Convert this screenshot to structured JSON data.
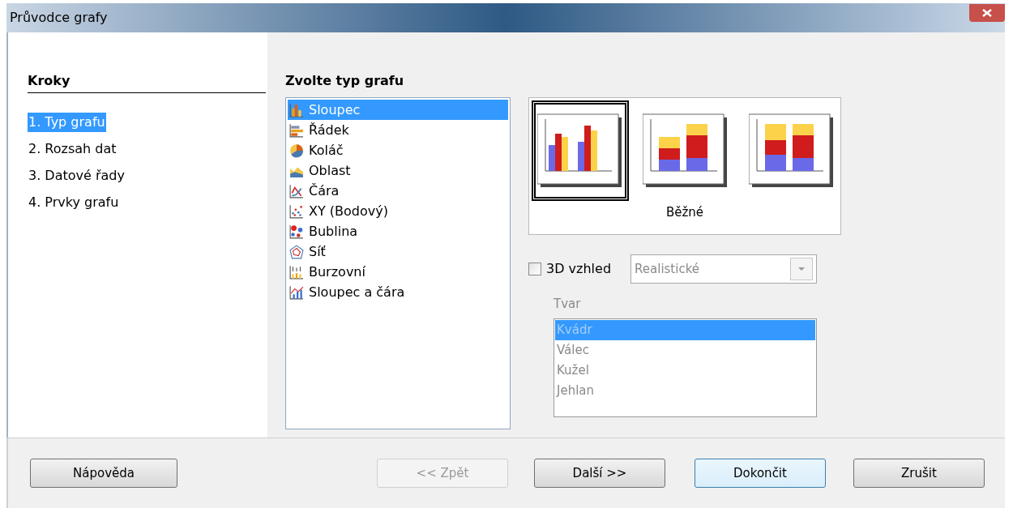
{
  "window": {
    "title": "Průvodce grafy"
  },
  "steps": {
    "title": "Kroky",
    "items": [
      {
        "label": "1. Typ grafu",
        "selected": true
      },
      {
        "label": "2. Rozsah dat",
        "selected": false
      },
      {
        "label": "3. Datové řady",
        "selected": false
      },
      {
        "label": "4. Prvky grafu",
        "selected": false
      }
    ]
  },
  "chart_type": {
    "title": "Zvolte typ grafu",
    "types": [
      {
        "label": "Sloupec",
        "kind": "column",
        "selected": true
      },
      {
        "label": "Řádek",
        "kind": "bar",
        "selected": false
      },
      {
        "label": "Koláč",
        "kind": "pie",
        "selected": false
      },
      {
        "label": "Oblast",
        "kind": "area",
        "selected": false
      },
      {
        "label": "Čára",
        "kind": "line",
        "selected": false
      },
      {
        "label": "XY (Bodový)",
        "kind": "xy",
        "selected": false
      },
      {
        "label": "Bublina",
        "kind": "bubble",
        "selected": false
      },
      {
        "label": "Síť",
        "kind": "net",
        "selected": false
      },
      {
        "label": "Burzovní",
        "kind": "stock",
        "selected": false
      },
      {
        "label": "Sloupec a čára",
        "kind": "column_line",
        "selected": false
      }
    ]
  },
  "variants": {
    "items": [
      {
        "kind": "normal",
        "selected": true
      },
      {
        "kind": "stacked",
        "selected": false
      },
      {
        "kind": "percent",
        "selected": false
      }
    ],
    "caption": "Běžné"
  },
  "three_d": {
    "label": "3D vzhled",
    "checked": false,
    "scheme": {
      "value": "Realistické",
      "disabled": true
    }
  },
  "shape": {
    "label": "Tvar",
    "disabled": true,
    "items": [
      {
        "label": "Kvádr",
        "selected": true
      },
      {
        "label": "Válec",
        "selected": false
      },
      {
        "label": "Kužel",
        "selected": false
      },
      {
        "label": "Jehlan",
        "selected": false
      }
    ]
  },
  "buttons": [
    {
      "label": "Nápověda",
      "disabled": false,
      "default": false
    },
    {
      "label": "<< Zpět",
      "disabled": true,
      "default": false
    },
    {
      "label": "Další >>",
      "disabled": false,
      "default": false
    },
    {
      "label": "Dokončit",
      "disabled": false,
      "default": true
    },
    {
      "label": "Zrušit",
      "disabled": false,
      "default": false
    }
  ]
}
